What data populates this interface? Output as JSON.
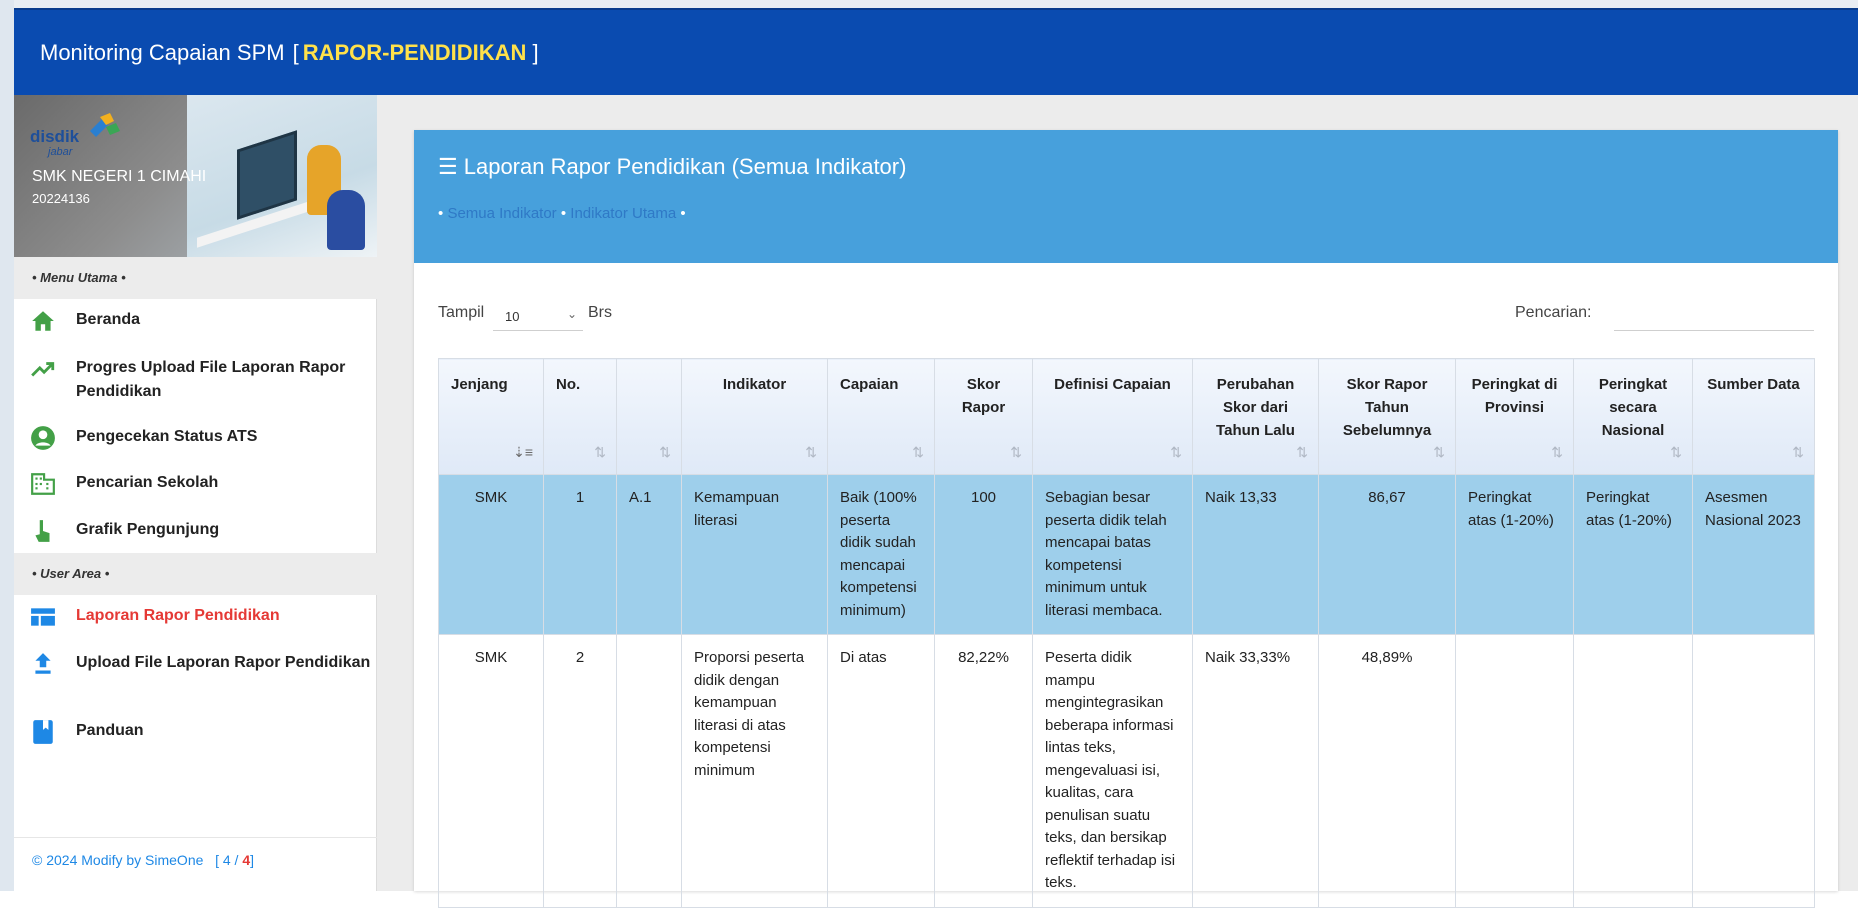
{
  "header": {
    "title": "Monitoring Capaian SPM",
    "bracket_open": "[",
    "highlight": "RAPOR-PENDIDIKAN",
    "bracket_close": "]"
  },
  "sidebar": {
    "logo_text": "disdik",
    "logo_sub": "jabar",
    "school_name": "SMK NEGERI 1 CIMAHI",
    "school_id": "20224136",
    "sections": {
      "main_menu": "• Menu Utama •",
      "user_area": "• User Area •"
    },
    "items": [
      {
        "label": "Beranda",
        "icon": "home-icon",
        "color": "#43a047"
      },
      {
        "label": "Progres Upload File Laporan Rapor Pendidikan",
        "icon": "trending-up-icon",
        "color": "#43a047"
      },
      {
        "label": "Pengecekan Status ATS",
        "icon": "account-circle-icon",
        "color": "#43a047"
      },
      {
        "label": "Pencarian Sekolah",
        "icon": "building-icon",
        "color": "#43a047"
      },
      {
        "label": "Grafik Pengunjung",
        "icon": "touch-hand-icon",
        "color": "#43a047"
      },
      {
        "label": "Laporan Rapor Pendidikan",
        "icon": "table-layout-icon",
        "color": "#1e88e5",
        "active": true
      },
      {
        "label": "Upload File Laporan Rapor Pendidikan",
        "icon": "upload-icon",
        "color": "#1e88e5"
      },
      {
        "label": "Panduan",
        "icon": "book-icon",
        "color": "#1e88e5"
      }
    ],
    "footer": {
      "text": "© 2024 Modify by SimeOne",
      "page_open": "[ 4 /",
      "page_total": "4",
      "page_close": "]"
    }
  },
  "card": {
    "menu_glyph": "☰",
    "title": "Laporan Rapor Pendidikan (Semua Indikator)",
    "links": [
      "Semua Indikator",
      "Indikator Utama"
    ],
    "bullet": "•"
  },
  "controls": {
    "show_label": "Tampil",
    "page_size": "10",
    "rows_label": "Brs",
    "search_label": "Pencarian:",
    "search_value": ""
  },
  "table": {
    "columns": [
      "Jenjang",
      "No.",
      "",
      "Indikator",
      "Capaian",
      "Skor Rapor",
      "Definisi Capaian",
      "Perubahan Skor dari Tahun Lalu",
      "Skor Rapor Tahun Sebelumnya",
      "Peringkat di Provinsi",
      "Peringkat secara Nasional",
      "Sumber Data"
    ],
    "rows": [
      [
        "SMK",
        "1",
        "A.1",
        "Kemampuan literasi",
        "Baik (100% peserta didik sudah mencapai kompetensi minimum)",
        "100",
        "Sebagian besar peserta didik telah mencapai batas kompetensi minimum untuk literasi membaca.",
        "Naik 13,33",
        "86,67",
        "Peringkat atas (1-20%)",
        "Peringkat atas (1-20%)",
        "Asesmen Nasional 2023"
      ],
      [
        "SMK",
        "2",
        "",
        "Proporsi peserta didik dengan kemampuan literasi di atas kompetensi minimum",
        "Di atas",
        "82,22%",
        "Peserta didik mampu mengintegrasikan beberapa informasi lintas teks, mengevaluasi isi, kualitas, cara penulisan suatu teks, dan bersikap reflektif terhadap isi teks.",
        "Naik 33,33%",
        "48,89%",
        "",
        "",
        ""
      ]
    ]
  },
  "colors": {
    "topbar": "#0a4bb0",
    "highlight": "#ffe14a",
    "card_header": "#47a0dc",
    "selected_row": "#9ecfeb",
    "active_menu": "#e53935"
  }
}
